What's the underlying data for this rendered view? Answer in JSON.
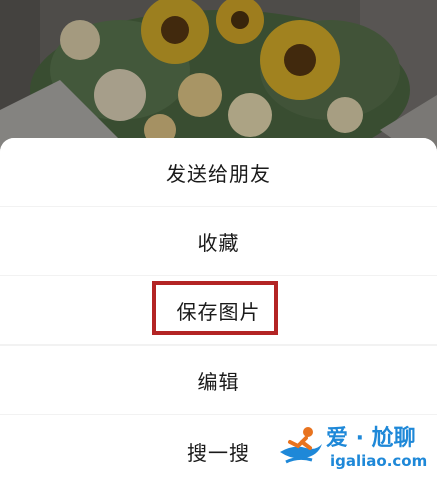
{
  "action_sheet": {
    "items": [
      {
        "label": "发送给朋友"
      },
      {
        "label": "收藏"
      },
      {
        "label": "保存图片",
        "highlighted": true
      },
      {
        "label": "编辑"
      },
      {
        "label": "搜一搜"
      }
    ],
    "highlight_color": "#b32424"
  },
  "watermark": {
    "text_cn": "爱 · 尬聊",
    "text_en": "igaliao.com",
    "color": "#1e88d8",
    "logo": "runner-logo-icon"
  },
  "background": {
    "description_icon": "flower-bouquet-photo"
  }
}
